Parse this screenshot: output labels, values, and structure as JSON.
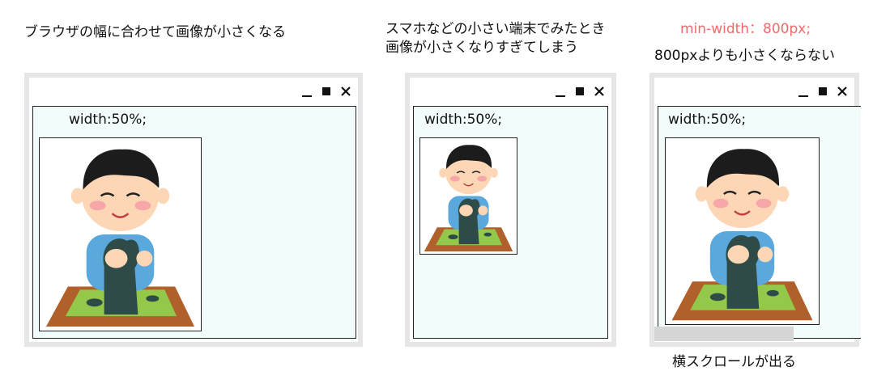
{
  "panels": [
    {
      "caption_lines": [
        "ブラウザの幅に合わせて画像が小さくなる"
      ],
      "width_label": "width:50%;"
    },
    {
      "caption_lines": [
        "スマホなどの小さい端末でみたとき",
        "画像が小さくなりすぎてしまう"
      ],
      "width_label": "width:50%;"
    },
    {
      "caption_top": "min-width：800px;",
      "caption_lines": [
        "800pxよりも小さくならない"
      ],
      "width_label": "width:50%;",
      "bottom_caption": "横スクロールが出る"
    }
  ],
  "colors": {
    "accent_red": "#f06a6a",
    "content_bg": "#f2fcfb",
    "frame": "#e6e6e6",
    "scrollbar": "#d6d6d6"
  },
  "icons": [
    "minimize-icon",
    "maximize-icon",
    "close-icon"
  ]
}
